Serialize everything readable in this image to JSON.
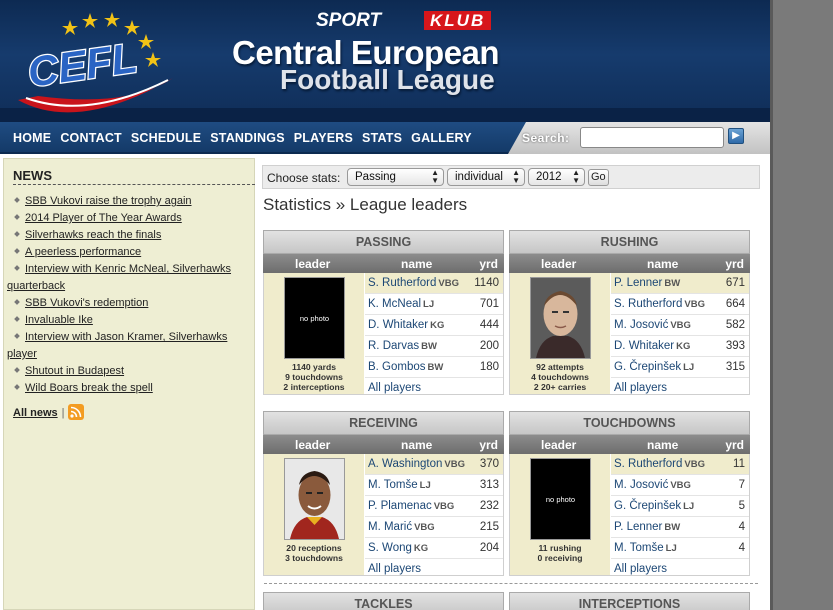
{
  "header": {
    "logo_text": "CEFL",
    "sponsor_part1": "SPORT",
    "sponsor_part2": "KLUB",
    "title_line1": "Central European",
    "title_line2": "Football League"
  },
  "nav": {
    "items": [
      "HOME",
      "CONTACT",
      "SCHEDULE",
      "STANDINGS",
      "PLAYERS",
      "STATS",
      "GALLERY"
    ],
    "search_label": "Search:",
    "search_value": ""
  },
  "news": {
    "title": "NEWS",
    "items": [
      "SBB Vukovi raise the trophy again",
      "2014 Player of The Year Awards",
      "Silverhawks reach the finals",
      "A peerless performance",
      "Interview with Kenric McNeal, Silverhawks quarterback",
      "SBB Vukovi's redemption",
      "Invaluable Ike",
      "Interview with Jason Kramer, Silverhawks player",
      "Shutout in Budapest",
      "Wild Boars break the spell"
    ],
    "all_news": "All news",
    "separator": "|"
  },
  "stats_form": {
    "label": "Choose stats:",
    "category": "Passing",
    "mode": "individual",
    "year": "2012",
    "go": "Go"
  },
  "page_title": "Statistics » League leaders",
  "col_headers": {
    "leader": "leader",
    "name": "name",
    "value": "yrd"
  },
  "panels": [
    {
      "title": "PASSING",
      "photo": "no photo",
      "leader_lines": [
        "1140 yards",
        "9 touchdowns",
        "2 interceptions"
      ],
      "rows": [
        {
          "name": "S. Rutherford",
          "team": "VBG",
          "value": "1140"
        },
        {
          "name": "K. McNeal",
          "team": "LJ",
          "value": "701"
        },
        {
          "name": "D. Whitaker",
          "team": "KG",
          "value": "444"
        },
        {
          "name": "R. Darvas",
          "team": "BW",
          "value": "200"
        },
        {
          "name": "B. Gombos",
          "team": "BW",
          "value": "180"
        }
      ],
      "all": "All players"
    },
    {
      "title": "RUSHING",
      "photo": "",
      "leader_lines": [
        "92 attempts",
        "4 touchdowns",
        "2 20+ carries"
      ],
      "rows": [
        {
          "name": "P. Lenner",
          "team": "BW",
          "value": "671"
        },
        {
          "name": "S. Rutherford",
          "team": "VBG",
          "value": "664"
        },
        {
          "name": "M. Josović",
          "team": "VBG",
          "value": "582"
        },
        {
          "name": "D. Whitaker",
          "team": "KG",
          "value": "393"
        },
        {
          "name": "G. Črepinšek",
          "team": "LJ",
          "value": "315"
        }
      ],
      "all": "All players"
    },
    {
      "title": "RECEIVING",
      "photo": "",
      "leader_lines": [
        "20 receptions",
        "3 touchdowns"
      ],
      "rows": [
        {
          "name": "A. Washington",
          "team": "VBG",
          "value": "370"
        },
        {
          "name": "M. Tomše",
          "team": "LJ",
          "value": "313"
        },
        {
          "name": "P. Plamenac",
          "team": "VBG",
          "value": "232"
        },
        {
          "name": "M. Marić",
          "team": "VBG",
          "value": "215"
        },
        {
          "name": "S. Wong",
          "team": "KG",
          "value": "204"
        }
      ],
      "all": "All players"
    },
    {
      "title": "TOUCHDOWNS",
      "photo": "no photo",
      "leader_lines": [
        "11 rushing",
        "0 receiving"
      ],
      "rows": [
        {
          "name": "S. Rutherford",
          "team": "VBG",
          "value": "11"
        },
        {
          "name": "M. Josović",
          "team": "VBG",
          "value": "7"
        },
        {
          "name": "G. Črepinšek",
          "team": "LJ",
          "value": "5"
        },
        {
          "name": "P. Lenner",
          "team": "BW",
          "value": "4"
        },
        {
          "name": "M. Tomše",
          "team": "LJ",
          "value": "4"
        }
      ],
      "all": "All players"
    }
  ],
  "bottom_panels": [
    "TACKLES",
    "INTERCEPTIONS"
  ]
}
